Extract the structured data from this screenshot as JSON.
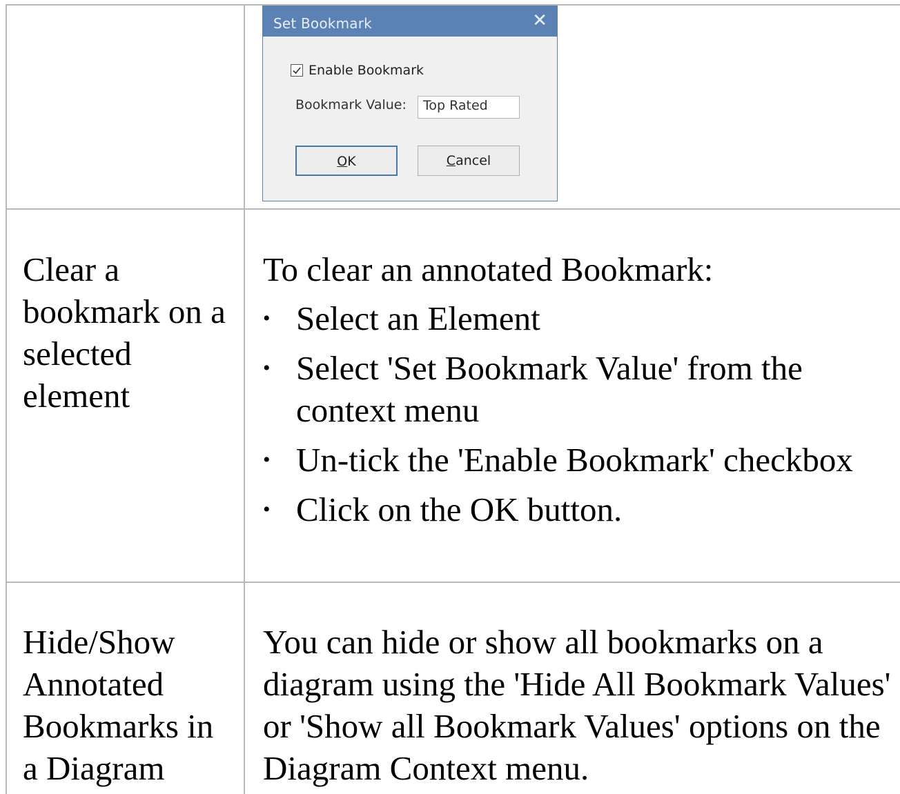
{
  "dialog": {
    "title": "Set Bookmark",
    "close_glyph": "✕",
    "enable_checkbox": {
      "label": "Enable Bookmark",
      "checked": true
    },
    "value_label": "Bookmark Value:",
    "value": "Top Rated",
    "ok_accel": "O",
    "ok_rest": "K",
    "cancel_accel": "C",
    "cancel_rest": "ancel"
  },
  "rows": [
    {
      "label": "Clear a bookmark on a selected element",
      "intro": "To clear an annotated Bookmark:",
      "steps": [
        "Select an Element",
        "Select 'Set Bookmark Value' from the context menu",
        "Un-tick the 'Enable Bookmark' checkbox",
        "Click on the OK button."
      ]
    },
    {
      "label": "Hide/Show Annotated Bookmarks in a Diagram",
      "text": "You can hide or show all bookmarks on a diagram using the 'Hide All Bookmark Values' or 'Show all Bookmark Values' options on the Diagram Context menu."
    }
  ]
}
